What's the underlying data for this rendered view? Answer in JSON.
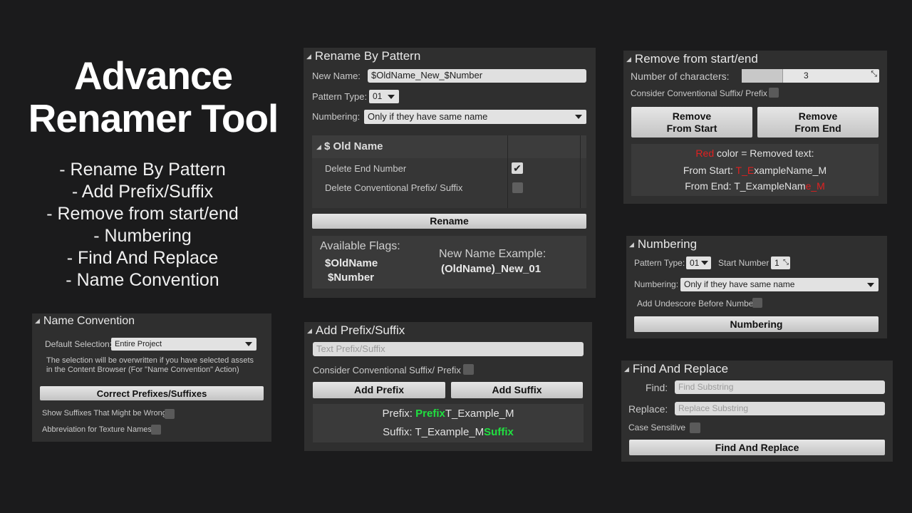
{
  "hero": {
    "title_line1": "Advance",
    "title_line2": "Renamer Tool",
    "features": [
      "- Rename By Pattern",
      "- Add Prefix/Suffix",
      "- Remove from start/end",
      "- Numbering",
      "- Find And Replace",
      "- Name Convention"
    ]
  },
  "rename_by_pattern": {
    "title": "Rename By Pattern",
    "new_name_label": "New Name:",
    "new_name_value": "$OldName_New_$Number",
    "pattern_type_label": "Pattern Type:",
    "pattern_type_value": "01",
    "numbering_label": "Numbering:",
    "numbering_value": "Only if they have same name",
    "old_name_header": "$ Old Name",
    "delete_end_number": "Delete End Number",
    "delete_conventional": "Delete Conventional Prefix/ Suffix",
    "rename_button": "Rename",
    "available_flags_label": "Available Flags:",
    "flag1": "$OldName",
    "flag2": "$Number",
    "example_label": "New Name Example:",
    "example_value": "(OldName)_New_01"
  },
  "remove": {
    "title": "Remove from start/end",
    "num_chars_label": "Number of characters:",
    "num_chars_value": "3",
    "consider_label": "Consider Conventional Suffix/ Prefix",
    "remove_start_1": "Remove",
    "remove_start_2": "From Start",
    "remove_end_1": "Remove",
    "remove_end_2": "From End",
    "legend_red": "Red",
    "legend_rest": " color = Removed text:",
    "from_start_label": "From Start: ",
    "from_start_removed": "T_E",
    "from_start_rest": "xampleName_M",
    "from_end_label": "From End: ",
    "from_end_rest": "T_ExampleNam",
    "from_end_removed": "e_M"
  },
  "numbering": {
    "title": "Numbering",
    "pattern_type_label": "Pattern Type:",
    "pattern_type_value": "01",
    "start_number_label": "Start Number",
    "start_number_value": "1",
    "numbering_label": "Numbering:",
    "numbering_value": "Only if they have same name",
    "add_underscore_label": "Add Undescore Before Number",
    "button": "Numbering"
  },
  "prefix_suffix": {
    "title": "Add Prefix/Suffix",
    "placeholder": "Text Prefix/Suffix",
    "consider_label": "Consider Conventional Suffix/ Prefix",
    "add_prefix": "Add Prefix",
    "add_suffix": "Add Suffix",
    "prefix_label": "Prefix: ",
    "prefix_word": "Prefix",
    "prefix_rest": "T_Example_M",
    "suffix_label": "Suffix: ",
    "suffix_base": "T_Example_M",
    "suffix_word": "Suffix"
  },
  "find_replace": {
    "title": "Find And Replace",
    "find_label": "Find:",
    "find_placeholder": "Find Substring",
    "replace_label": "Replace:",
    "replace_placeholder": "Replace Substring",
    "case_label": "Case Sensitive",
    "button": "Find And Replace"
  },
  "name_convention": {
    "title": "Name Convention",
    "default_selection_label": "Default Selection:",
    "default_selection_value": "Entire Project",
    "note_line1": "The selection will be overwritten if you have selected assets",
    "note_line2": "in the Content Browser (For \"Name Convention\" Action)",
    "button": "Correct Prefixes/Suffixes",
    "show_suffixes_label": "Show Suffixes That Might be Wrong",
    "abbreviation_label": "Abbreviation for Texture Names"
  }
}
